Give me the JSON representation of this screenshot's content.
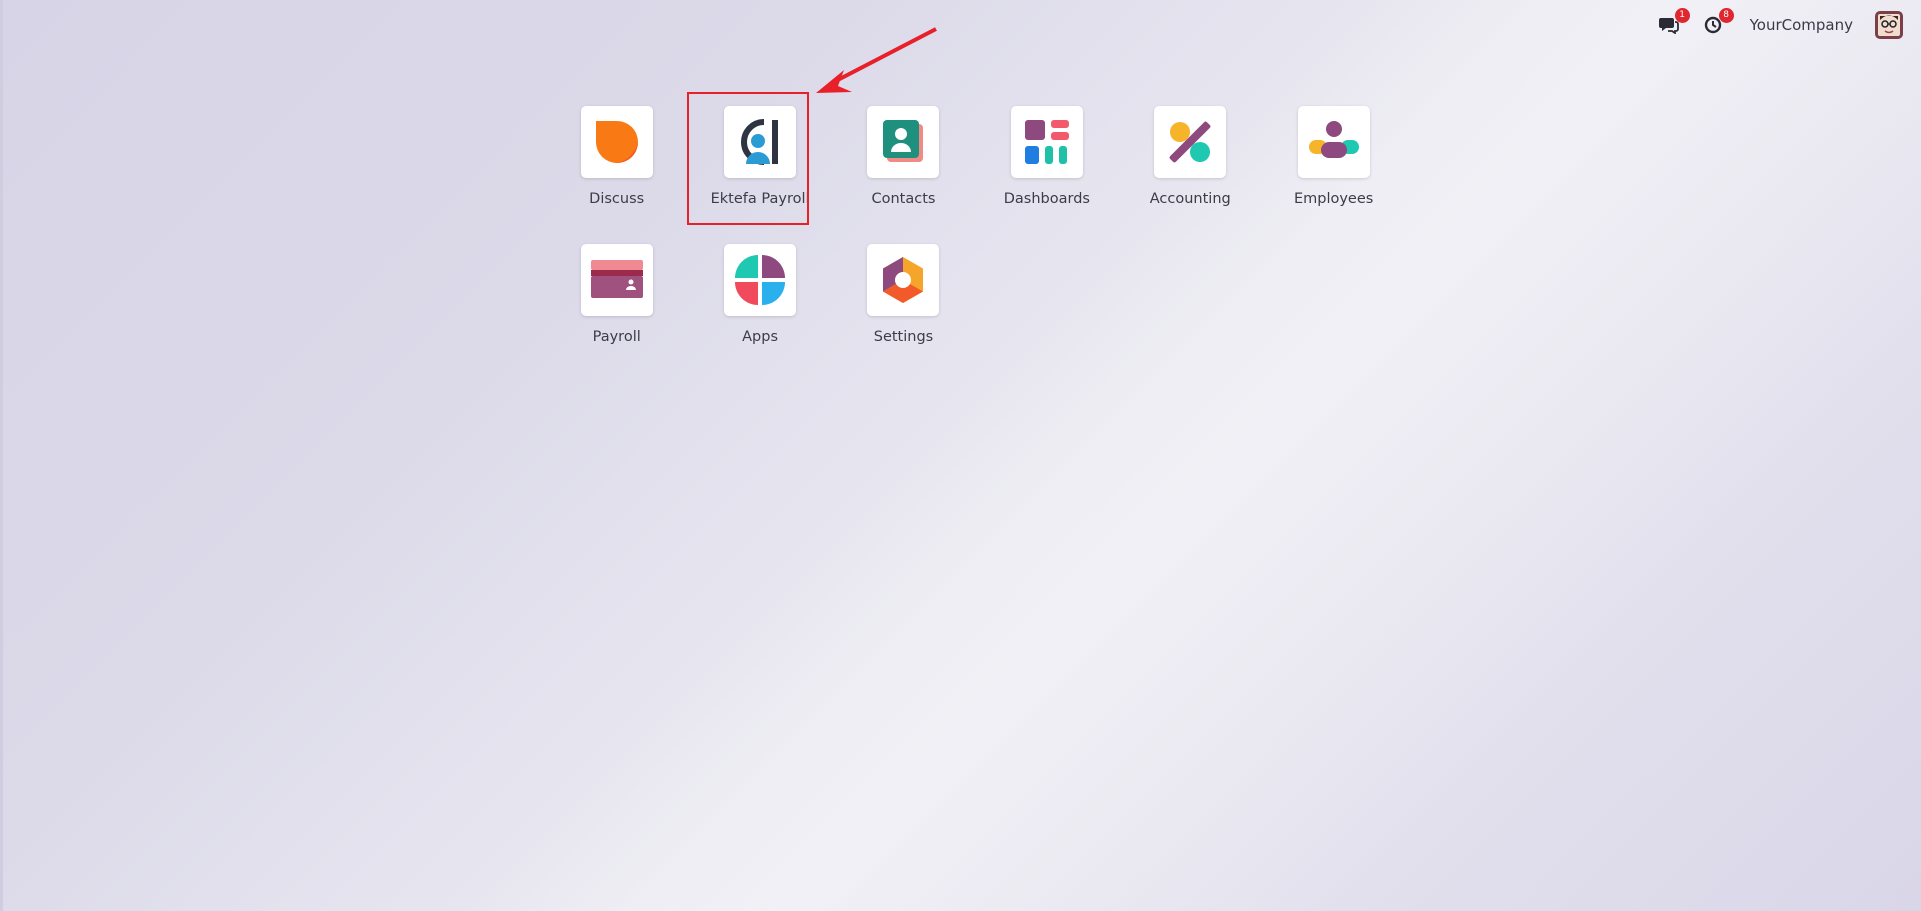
{
  "topbar": {
    "chat_count": "1",
    "activity_count": "8",
    "company_name": "YourCompany"
  },
  "apps": [
    {
      "label": "Discuss",
      "icon": "discuss-icon"
    },
    {
      "label": "Ektefa Payroll",
      "icon": "ektefa-payroll-icon"
    },
    {
      "label": "Contacts",
      "icon": "contacts-icon"
    },
    {
      "label": "Dashboards",
      "icon": "dashboards-icon"
    },
    {
      "label": "Accounting",
      "icon": "accounting-icon"
    },
    {
      "label": "Employees",
      "icon": "employees-icon"
    },
    {
      "label": "Payroll",
      "icon": "payroll-icon"
    },
    {
      "label": "Apps",
      "icon": "apps-icon"
    },
    {
      "label": "Settings",
      "icon": "settings-icon"
    }
  ],
  "colors": {
    "highlight": "#e8202a",
    "badge": "#e0262f"
  }
}
